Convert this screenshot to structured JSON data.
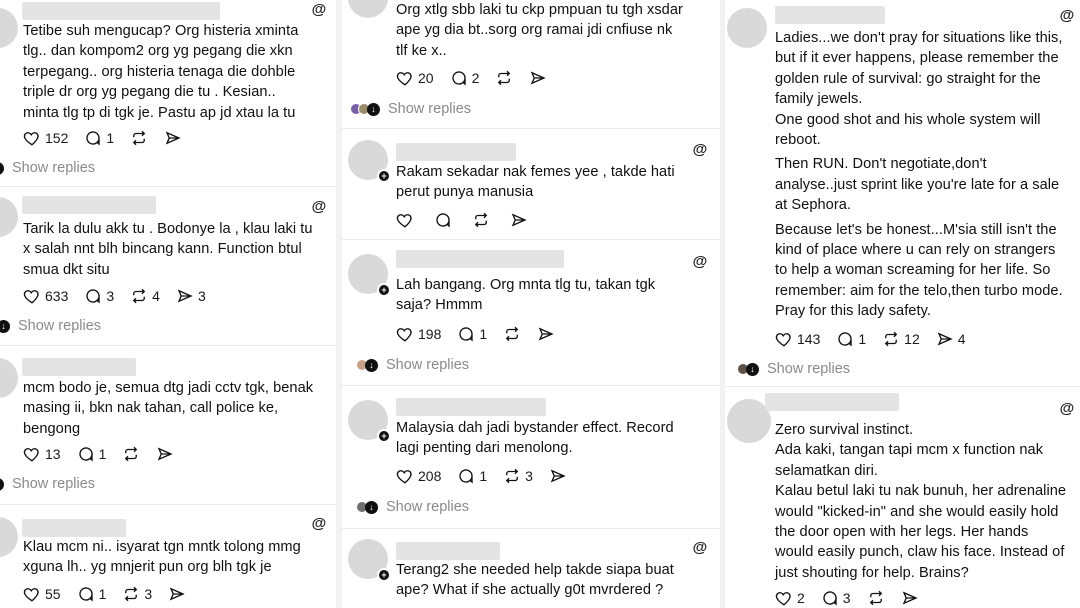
{
  "common": {
    "show_replies": "Show replies",
    "threads_glyph": "@"
  },
  "left": [
    {
      "lines": [
        "Tetibe suh mengucap? Org histeria xminta",
        "tlg.. dan kompom2 org yg pegang die xkn",
        "terpegang.. org histeria tenaga die dohble",
        "triple dr org yg pegang die tu . Kesian..",
        "minta tlg tp di tgk je. Pastu ap jd xtau la tu"
      ],
      "likes": "152",
      "replies": "1",
      "reposts": "",
      "shares": ""
    },
    {
      "lines": [
        "Tarik la dulu akk tu . Bodonye la , klau laki tu",
        "x salah nnt blh bincang kann. Function btul",
        "smua dkt situ"
      ],
      "likes": "633",
      "replies": "3",
      "reposts": "4",
      "shares": "3"
    },
    {
      "lines": [
        "mcm bodo je, semua dtg jadi cctv tgk, benak",
        "masing ii, bkn nak tahan, call police ke,",
        "bengong"
      ],
      "likes": "13",
      "replies": "1",
      "reposts": "",
      "shares": ""
    },
    {
      "lines": [
        "Klau mcm ni.. isyarat tgn mntk tolong mmg",
        "xguna lh.. yg mnjerit pun org blh tgk je"
      ],
      "likes": "55",
      "replies": "1",
      "reposts": "3",
      "shares": ""
    }
  ],
  "mid": [
    {
      "lines": [
        "Org xtlg sbb laki tu ckp pmpuan tu tgh xsdar",
        "ape yg dia bt..sorg org ramai jdi cnfiuse nk",
        "tlf ke x.."
      ],
      "likes": "20",
      "replies": "2",
      "reposts": "",
      "shares": ""
    },
    {
      "lines": [
        "Rakam sekadar nak femes yee , takde hati",
        "perut punya manusia"
      ],
      "likes": "",
      "replies": "",
      "reposts": "",
      "shares": ""
    },
    {
      "lines": [
        "Lah bangang. Org mnta tlg tu, takan tgk",
        "saja? Hmmm"
      ],
      "likes": "198",
      "replies": "1",
      "reposts": "",
      "shares": ""
    },
    {
      "lines": [
        "Malaysia dah jadi bystander effect. Record",
        "lagi penting dari menolong."
      ],
      "likes": "208",
      "replies": "1",
      "reposts": "3",
      "shares": ""
    },
    {
      "lines": [
        "Terang2 she needed help takde siapa buat",
        "ape? What if she actually g0t mvrdered ?"
      ],
      "likes": "",
      "replies": "",
      "reposts": "",
      "shares": ""
    }
  ],
  "right": [
    {
      "paras": [
        [
          "Ladies...we don't pray for situations like this,",
          "but if it ever happens, please remember the",
          "golden rule of survival: go straight for the",
          "family jewels.",
          "One good shot and his whole system will",
          "reboot."
        ],
        [
          "Then RUN. Don't negotiate,don't",
          "analyse..just sprint like you're late for a sale",
          "at Sephora."
        ],
        [
          "Because let's be honest...M'sia still isn't the",
          "kind of place where u can rely on strangers",
          "to help a woman screaming for her life. So",
          "remember: aim for the telo,then turbo mode.",
          "Pray for this lady safety."
        ]
      ],
      "likes": "143",
      "replies": "1",
      "reposts": "12",
      "shares": "4"
    },
    {
      "paras": [
        [
          "Zero survival instinct.",
          "Ada kaki, tangan tapi mcm x function nak",
          "selamatkan diri.",
          "Kalau betul laki tu nak bunuh, her adrenaline",
          "would \"kicked-in\" and she would easily hold",
          "the door open with her legs. Her hands",
          "would easily punch, claw his face. Instead of",
          "just shouting for help. Brains?"
        ]
      ],
      "likes": "2",
      "replies": "3",
      "reposts": "",
      "shares": ""
    }
  ]
}
